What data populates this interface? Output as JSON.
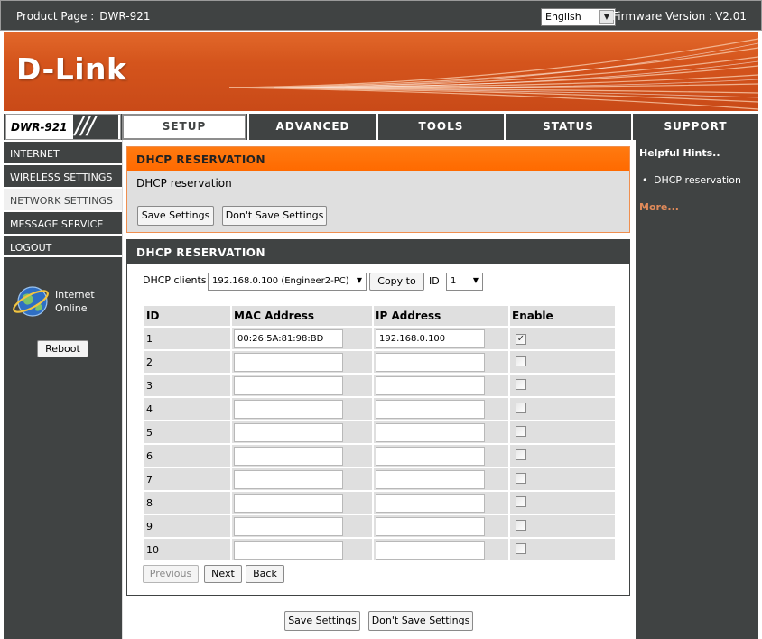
{
  "topbar": {
    "product_label": "Product Page :",
    "product_value": "DWR-921",
    "language": "English",
    "firmware_label": "Firmware Version :",
    "firmware_value": "V2.01"
  },
  "banner": {
    "logo": "D-Link"
  },
  "nav": {
    "model": "DWR-921",
    "slashes": "///",
    "tabs": [
      {
        "label": "SETUP",
        "active": true
      },
      {
        "label": "ADVANCED"
      },
      {
        "label": "TOOLS"
      },
      {
        "label": "STATUS"
      },
      {
        "label": "SUPPORT"
      }
    ]
  },
  "sidebar": {
    "items": [
      {
        "label": "INTERNET"
      },
      {
        "label": "WIRELESS SETTINGS"
      },
      {
        "label": "NETWORK SETTINGS",
        "active": true
      },
      {
        "label": "MESSAGE SERVICE"
      },
      {
        "label": "LOGOUT"
      }
    ],
    "status_line1": "Internet",
    "status_line2": "Online",
    "reboot_label": "Reboot"
  },
  "hints": {
    "title": "Helpful Hints..",
    "items": [
      "DHCP reservation"
    ],
    "more": "More..."
  },
  "section1": {
    "title": "DHCP RESERVATION",
    "description": "DHCP reservation",
    "save_label": "Save Settings",
    "dont_save_label": "Don't Save Settings"
  },
  "section2": {
    "title": "DHCP RESERVATION",
    "clients_label": "DHCP clients",
    "clients_value": "192.168.0.100 (Engineer2-PC)",
    "copy_label": "Copy to",
    "id_label": "ID",
    "id_value": "1",
    "table": {
      "headers": [
        "ID",
        "MAC Address",
        "IP Address",
        "Enable"
      ],
      "rows": [
        {
          "id": "1",
          "mac": "00:26:5A:81:98:BD",
          "ip": "192.168.0.100",
          "enabled": true
        },
        {
          "id": "2",
          "mac": "",
          "ip": "",
          "enabled": false
        },
        {
          "id": "3",
          "mac": "",
          "ip": "",
          "enabled": false
        },
        {
          "id": "4",
          "mac": "",
          "ip": "",
          "enabled": false
        },
        {
          "id": "5",
          "mac": "",
          "ip": "",
          "enabled": false
        },
        {
          "id": "6",
          "mac": "",
          "ip": "",
          "enabled": false
        },
        {
          "id": "7",
          "mac": "",
          "ip": "",
          "enabled": false
        },
        {
          "id": "8",
          "mac": "",
          "ip": "",
          "enabled": false
        },
        {
          "id": "9",
          "mac": "",
          "ip": "",
          "enabled": false
        },
        {
          "id": "10",
          "mac": "",
          "ip": "",
          "enabled": false
        }
      ]
    },
    "previous_label": "Previous",
    "next_label": "Next",
    "back_label": "Back"
  },
  "footer": {
    "save_label": "Save Settings",
    "dont_save_label": "Don't Save Settings"
  },
  "colors": {
    "dark": "#404343",
    "orange": "#ff6a00",
    "panel": "#dfdfdf"
  }
}
